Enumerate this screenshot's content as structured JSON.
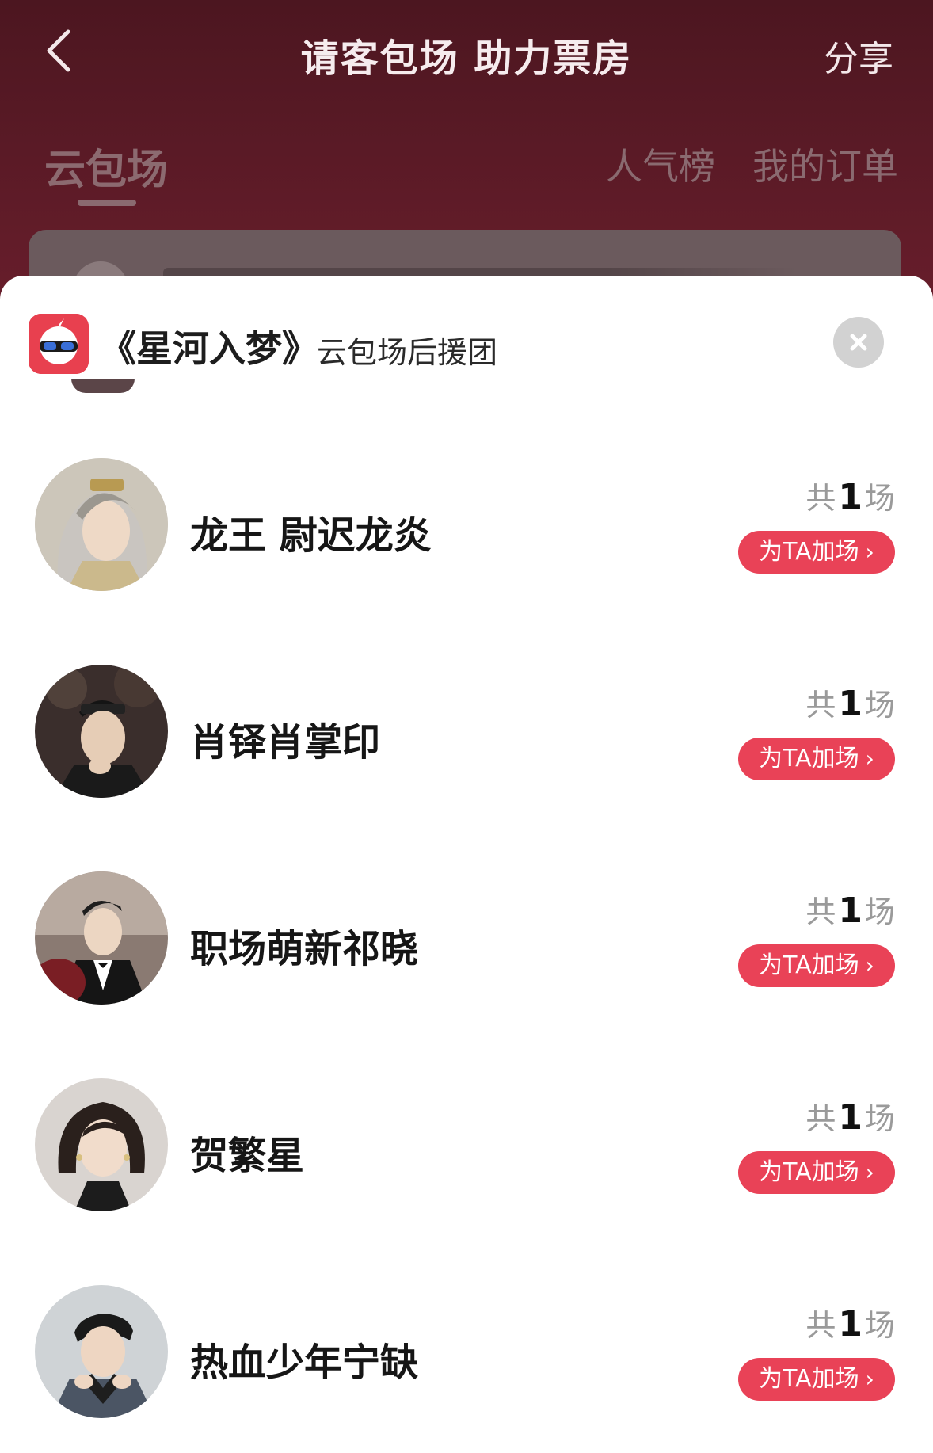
{
  "header": {
    "title": "请客包场 助力票房",
    "share_label": "分享"
  },
  "tabs": {
    "cloud": "云包场",
    "popular": "人气榜",
    "orders": "我的订单"
  },
  "sheet": {
    "title": "《星河入梦》",
    "subtitle": "云包场后援团"
  },
  "items": [
    {
      "name": "龙王 尉迟龙炎",
      "count_prefix": "共",
      "count": "1",
      "count_suffix": "场",
      "button": "为TA加场"
    },
    {
      "name": "肖铎肖掌印",
      "count_prefix": "共",
      "count": "1",
      "count_suffix": "场",
      "button": "为TA加场"
    },
    {
      "name": "职场萌新祁晓",
      "count_prefix": "共",
      "count": "1",
      "count_suffix": "场",
      "button": "为TA加场"
    },
    {
      "name": "贺繁星",
      "count_prefix": "共",
      "count": "1",
      "count_suffix": "场",
      "button": "为TA加场"
    },
    {
      "name": "热血少年宁缺",
      "count_prefix": "共",
      "count": "1",
      "count_suffix": "场",
      "button": "为TA加场"
    }
  ],
  "icons": {
    "back": "chevron-left-icon",
    "close": "close-icon",
    "logo": "app-logo-icon",
    "chevron": "chevron-right-icon"
  },
  "colors": {
    "header_bg": "#5a1a26",
    "accent": "#e94257",
    "logo_bg": "#e8404f"
  }
}
